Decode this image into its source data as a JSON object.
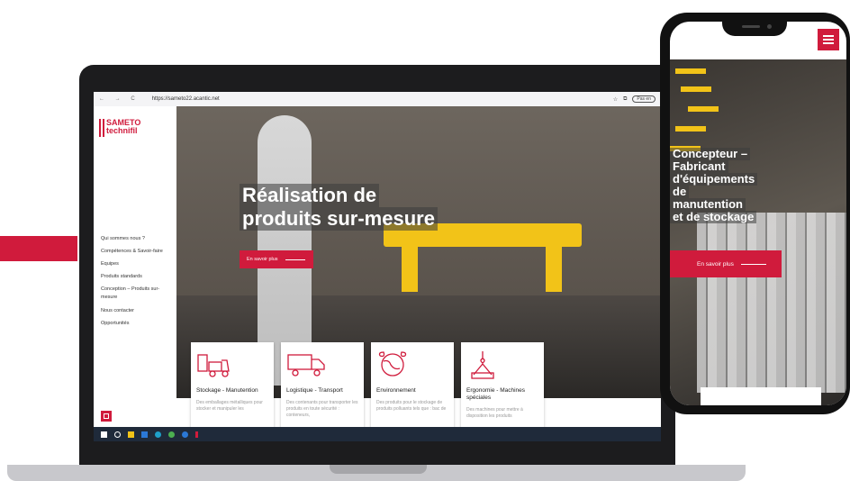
{
  "browser": {
    "url": "https://sameto22.acantic.net",
    "nav_icons": "← → C",
    "right_pill": "Pas en"
  },
  "sidebar": {
    "logo_line1": "SAMETO",
    "logo_line2": "technifil",
    "items": [
      {
        "label": "Qui sommes nous ?"
      },
      {
        "label": "Compétences & Savoir-faire"
      },
      {
        "label": "Equipes"
      },
      {
        "label": "Produits standards"
      },
      {
        "label": "Conception – Produits sur-"
      },
      {
        "label": "mesure"
      },
      {
        "label": "Nous contacter"
      },
      {
        "label": "Opportunités"
      }
    ]
  },
  "hero": {
    "title_line1": "Réalisation de",
    "title_line2": "produits sur-mesure",
    "button": "En savoir plus"
  },
  "cards": [
    {
      "title": "Stockage - Manutention",
      "desc": "Des emballages métalliques pour stocker et manipuler les",
      "icon": "forklift-icon"
    },
    {
      "title": "Logistique - Transport",
      "desc": "Des contenants pour transporter les produits en toute sécurité : conteneurs,",
      "icon": "truck-icon"
    },
    {
      "title": "Environnement",
      "desc": "Des produits pour le stockage de produits polluants tels que : bac de",
      "icon": "globe-leaf-icon"
    },
    {
      "title": "Ergonomie - Machines spéciales",
      "desc": "Des machines pour mettre à disposition les produits",
      "icon": "hook-load-icon"
    }
  ],
  "phone": {
    "title_lines": [
      "Concepteur –",
      "Fabricant",
      "d'équipements",
      "de",
      "manutention",
      "et de stockage"
    ],
    "button": "En savoir plus"
  },
  "colors": {
    "accent": "#d01b3c",
    "yellow": "#f2c318"
  }
}
